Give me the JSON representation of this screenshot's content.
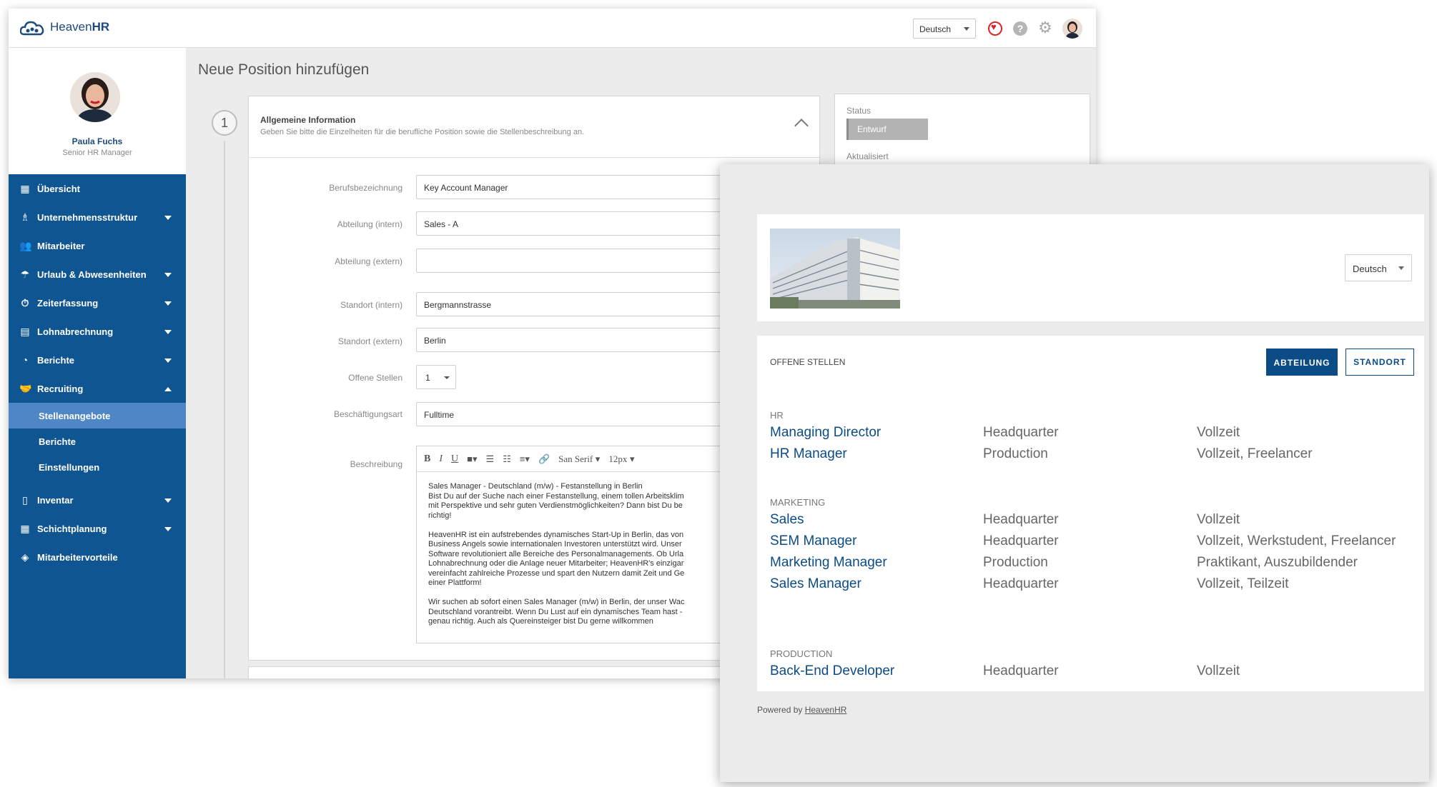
{
  "app": {
    "brand_light": "Heaven",
    "brand_bold": "HR",
    "language": "Deutsch",
    "user": {
      "name": "Paula Fuchs",
      "role": "Senior HR Manager"
    }
  },
  "sidebar": {
    "items": [
      {
        "label": "Übersicht",
        "icon": "dashboard-icon"
      },
      {
        "label": "Unternehmensstruktur",
        "icon": "org-chart-icon"
      },
      {
        "label": "Mitarbeiter",
        "icon": "people-icon"
      },
      {
        "label": "Urlaub & Abwesenheiten",
        "icon": "beach-icon"
      },
      {
        "label": "Zeiterfassung",
        "icon": "stopwatch-icon"
      },
      {
        "label": "Lohnabrechnung",
        "icon": "money-icon"
      },
      {
        "label": "Berichte",
        "icon": "pie-chart-icon"
      },
      {
        "label": "Recruiting",
        "icon": "handshake-icon"
      }
    ],
    "sub_items": [
      {
        "label": "Stellenangebote",
        "active": true
      },
      {
        "label": "Berichte"
      },
      {
        "label": "Einstellungen"
      }
    ],
    "items_after": [
      {
        "label": "Inventar",
        "icon": "phone-icon"
      },
      {
        "label": "Schichtplanung",
        "icon": "calendar-icon"
      },
      {
        "label": "Mitarbeitervorteile",
        "icon": "shield-icon"
      }
    ]
  },
  "main": {
    "page_title": "Neue Position hinzufügen",
    "step_number": "1",
    "section_title": "Allgemeine Information",
    "section_subtitle": "Geben Sie bitte die Einzelheiten für die berufliche Position sowie die Stellenbeschreibung an.",
    "fields": {
      "job_title": {
        "label": "Berufsbezeichnung",
        "value": "Key Account Manager"
      },
      "dept_internal": {
        "label": "Abteilung (intern)",
        "value": "Sales - A"
      },
      "dept_external": {
        "label": "Abteilung (extern)",
        "value": ""
      },
      "loc_internal": {
        "label": "Standort (intern)",
        "value": "Bergmannstrasse"
      },
      "loc_external": {
        "label": "Standort (extern)",
        "value": "Berlin"
      },
      "openings": {
        "label": "Offene Stellen",
        "value": "1"
      },
      "employment_type": {
        "label": "Beschäftigungsart",
        "value": "Fulltime"
      },
      "description": {
        "label": "Beschreibung",
        "font": "San Serif",
        "size": "12px",
        "text": "Sales Manager - Deutschland (m/w) - Festanstellung in Berlin\nBist Du auf der Suche nach einer Festanstellung, einem tollen Arbeitsklim\nmit Perspektive und sehr guten Verdienstmöglichkeiten? Dann bist Du be\nrichtig!\n\nHeavenHR ist ein aufstrebendes dynamisches Start-Up in Berlin, das von \nBusiness Angels sowie internationalen Investoren unterstützt wird. Unser\nSoftware revolutioniert alle Bereiche des Personalmanagements. Ob Urla\nLohnabrechnung oder die Anlage neuer Mitarbeiter; HeavenHR's einzigar\nvereinfacht zahlreiche Prozesse und spart den Nutzern damit Zeit und Ge\neiner Plattform!\n\nWir suchen ab sofort einen Sales Manager (m/w) in Berlin, der unser Wac\nDeutschland vorantreibt. Wenn Du Lust auf ein dynamisches Team hast -\ngenau richtig. Auch als Quereinsteiger bist Du gerne willkommen"
      }
    },
    "status": {
      "label": "Status",
      "value": "Entwurf",
      "updated_label": "Aktualisiert"
    }
  },
  "career": {
    "language": "Deutsch",
    "open_positions_label": "OFFENE STELLEN",
    "filter_department": "ABTEILUNG",
    "filter_location": "STANDORT",
    "departments": [
      {
        "name": "HR",
        "jobs": [
          {
            "title": "Managing Director",
            "location": "Headquarter",
            "type": "Vollzeit"
          },
          {
            "title": "HR Manager",
            "location": "Production",
            "type": "Vollzeit, Freelancer"
          }
        ]
      },
      {
        "name": "MARKETING",
        "jobs": [
          {
            "title": "Sales",
            "location": "Headquarter",
            "type": "Vollzeit"
          },
          {
            "title": "SEM Manager",
            "location": "Headquarter",
            "type": "Vollzeit, Werkstudent, Freelancer"
          },
          {
            "title": "Marketing Manager",
            "location": "Production",
            "type": "Praktikant, Auszubildender"
          },
          {
            "title": "Sales Manager",
            "location": "Headquarter",
            "type": "Vollzeit, Teilzeit"
          }
        ]
      },
      {
        "name": "PRODUCTION",
        "jobs": [
          {
            "title": "Back-End Developer",
            "location": "Headquarter",
            "type": "Vollzeit"
          }
        ]
      }
    ],
    "powered_by": "Powered by",
    "powered_link": "HeavenHR"
  },
  "colors": {
    "brand": "#0f5591",
    "active_sub": "#4f86c6",
    "accent_red": "#d9232d",
    "link": "#0b4b86"
  }
}
